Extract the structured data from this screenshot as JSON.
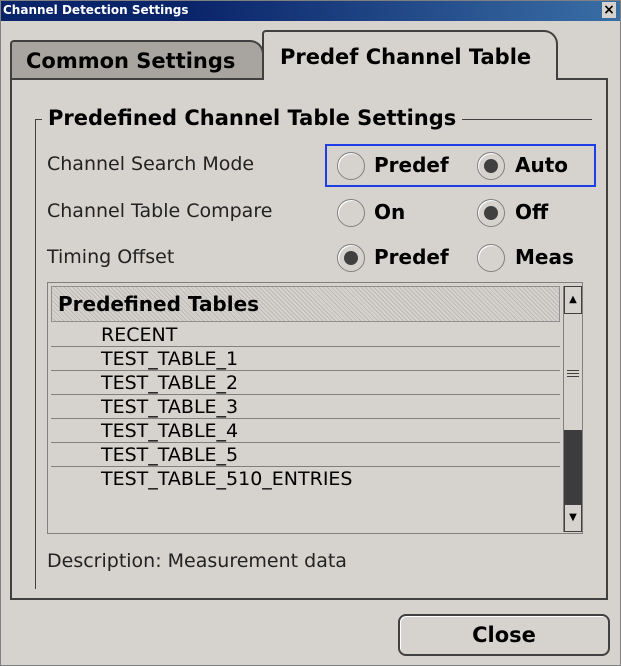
{
  "window": {
    "title": "Channel Detection Settings",
    "close_glyph": "×"
  },
  "tabs": [
    {
      "label": "Common Settings",
      "active": false
    },
    {
      "label": "Predef Channel Table",
      "active": true
    }
  ],
  "group": {
    "title": "Predefined Channel Table Settings",
    "rows": [
      {
        "label": "Channel Search Mode",
        "options": [
          {
            "label": "Predef",
            "selected": false
          },
          {
            "label": "Auto",
            "selected": true
          }
        ]
      },
      {
        "label": "Channel Table Compare",
        "options": [
          {
            "label": "On",
            "selected": false
          },
          {
            "label": "Off",
            "selected": true
          }
        ]
      },
      {
        "label": "Timing Offset",
        "options": [
          {
            "label": "Predef",
            "selected": true
          },
          {
            "label": "Meas",
            "selected": false
          }
        ]
      }
    ]
  },
  "table": {
    "header": "Predefined Tables",
    "rows": [
      "RECENT",
      "TEST_TABLE_1",
      "TEST_TABLE_2",
      "TEST_TABLE_3",
      "TEST_TABLE_4",
      "TEST_TABLE_5",
      "TEST_TABLE_510_ENTRIES"
    ]
  },
  "description": "Description: Measurement data",
  "buttons": {
    "close_label": "Close"
  },
  "icons": {
    "radio_selected": "radio-on",
    "radio_unselected": "radio-off",
    "scroll_up": "up-arrow-icon",
    "scroll_down": "down-arrow-icon"
  },
  "colors": {
    "titlebar": "#0a246a",
    "highlight": "#1f3ee8",
    "background": "#d6d3ce"
  }
}
